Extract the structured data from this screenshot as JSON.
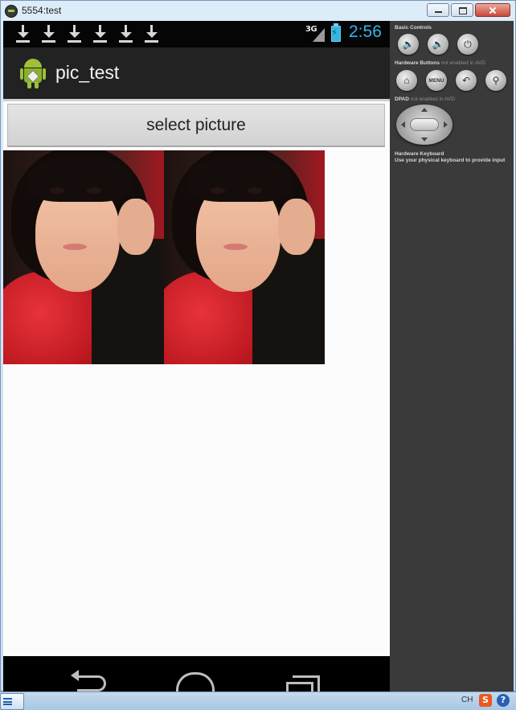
{
  "window": {
    "title": "5554:test",
    "buttons": [
      "minimize",
      "maximize",
      "close"
    ]
  },
  "statusbar": {
    "notification_icons": [
      "download-icon",
      "download-icon",
      "download-icon",
      "download-icon",
      "download-icon",
      "download-icon"
    ],
    "network": "3G",
    "time": "2:56",
    "time_color": "#33b5e5"
  },
  "actionbar": {
    "app_icon": "android-robot-icon",
    "title": "pic_test"
  },
  "main": {
    "select_button_label": "select picture",
    "images": [
      "photo-girl-red-scarf",
      "photo-girl-red-scarf"
    ]
  },
  "navbar": {
    "buttons": [
      "back-icon",
      "home-icon",
      "recent-apps-icon"
    ]
  },
  "control_panel": {
    "basic_controls_label": "Basic Controls",
    "basic_controls": [
      "volume-down-icon",
      "volume-up-icon",
      "power-icon"
    ],
    "hardware_buttons_label": "Hardware Buttons",
    "hardware_buttons_note": "not enabled in AVD",
    "hardware_buttons": [
      "home-icon",
      "menu",
      "back-icon",
      "search-icon"
    ],
    "menu_label": "MENU",
    "dpad_label": "DPAD",
    "dpad_note": "not enabled in AVD",
    "keyboard_label": "Hardware Keyboard",
    "keyboard_note": "Use your physical keyboard to provide input"
  },
  "taskbar": {
    "tray_lang": "CH",
    "tray_ime": "S",
    "tray_help": "?"
  }
}
